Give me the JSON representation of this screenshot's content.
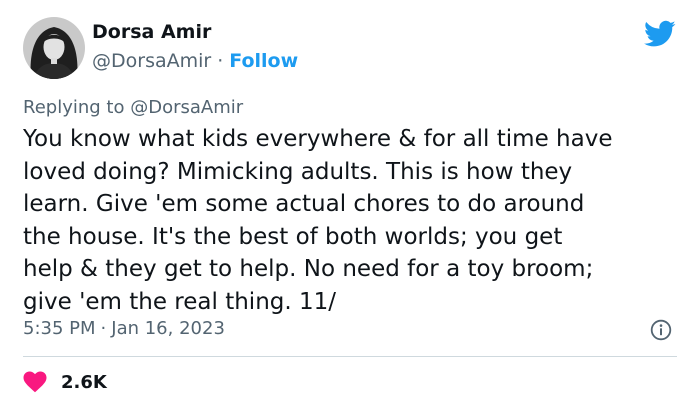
{
  "author": {
    "name": "Dorsa Amir",
    "handle": "@DorsaAmir",
    "separator": "·",
    "follow_label": "Follow"
  },
  "reply": {
    "prefix": "Replying to",
    "handle": "@DorsaAmir"
  },
  "tweet": {
    "lines": [
      "You know what kids everywhere & for all time have",
      "loved doing? Mimicking adults. This is how they",
      "learn. Give 'em some actual chores to do around",
      "the house. It's the best of both worlds; you get",
      "help & they get to help. No need for a toy broom;",
      "give 'em the real thing. 11/"
    ]
  },
  "meta": {
    "time": "5:35 PM",
    "separator": "·",
    "date": "Jan 16, 2023"
  },
  "engagement": {
    "likes": "2.6K"
  },
  "icons": {
    "logo": "twitter-bird-icon",
    "info": "info-icon",
    "like": "heart-icon"
  },
  "colors": {
    "accent": "#1d9bf0",
    "like": "#f91880",
    "secondary_text": "#536471",
    "primary_text": "#0f1419",
    "divider": "#cfd9de"
  }
}
